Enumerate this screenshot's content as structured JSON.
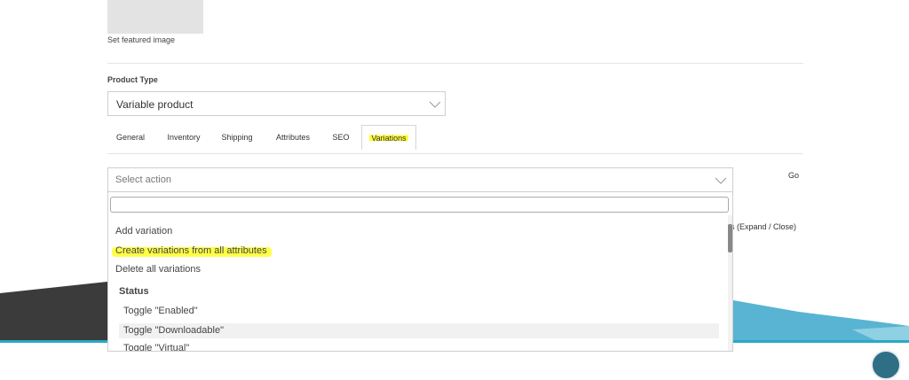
{
  "featured_image": {
    "link_label": "Set featured image"
  },
  "product_type": {
    "label": "Product Type",
    "selected": "Variable product"
  },
  "tabs": [
    {
      "label": "General"
    },
    {
      "label": "Inventory"
    },
    {
      "label": "Shipping"
    },
    {
      "label": "Attributes"
    },
    {
      "label": "SEO"
    },
    {
      "label": "Variations"
    }
  ],
  "variations": {
    "action_placeholder": "Select action",
    "go_label": "Go",
    "expand_close_label": "s (Expand / Close)",
    "dropdown": {
      "items": [
        {
          "label": "Add variation"
        },
        {
          "label": "Create variations from all attributes"
        },
        {
          "label": "Delete all variations"
        }
      ],
      "group_label": "Status",
      "group_items": [
        {
          "label": "Toggle \"Enabled\""
        },
        {
          "label": "Toggle \"Downloadable\""
        },
        {
          "label": "Toggle \"Virtual\""
        }
      ]
    }
  },
  "colors": {
    "highlight": "#ffff33",
    "accent_teal": "#2aa8c7",
    "dark_wave": "#3a3a3a"
  },
  "icons": {
    "chevron": "chevron-down-icon",
    "fab": "circle-button-icon"
  }
}
